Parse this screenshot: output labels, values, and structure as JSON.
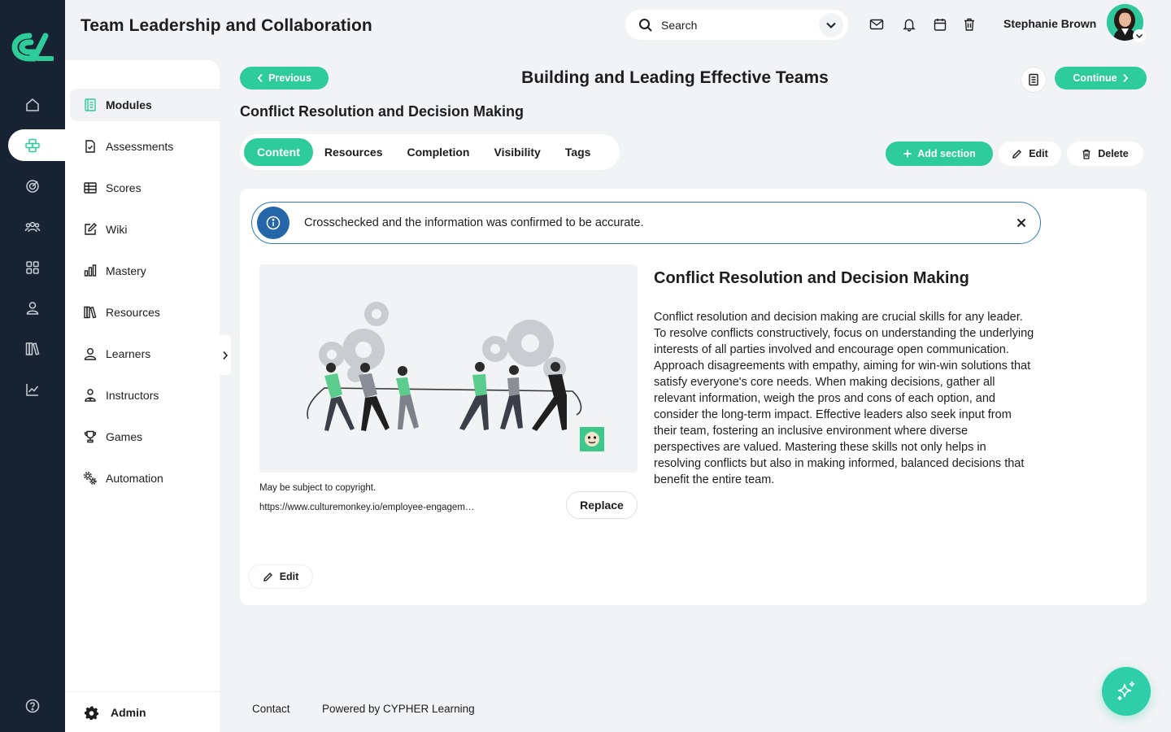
{
  "header": {
    "app_title": "Team Leadership and Collaboration",
    "search_placeholder": "Search",
    "user_name": "Stephanie Brown"
  },
  "sidebar": {
    "items": [
      {
        "label": "Modules",
        "icon": "modules-icon",
        "active": true
      },
      {
        "label": "Assessments",
        "icon": "assessments-icon"
      },
      {
        "label": "Scores",
        "icon": "scores-icon"
      },
      {
        "label": "Wiki",
        "icon": "wiki-icon"
      },
      {
        "label": "Mastery",
        "icon": "mastery-icon"
      },
      {
        "label": "Resources",
        "icon": "resources-icon"
      },
      {
        "label": "Learners",
        "icon": "learners-icon"
      },
      {
        "label": "Instructors",
        "icon": "instructors-icon"
      },
      {
        "label": "Games",
        "icon": "games-icon"
      },
      {
        "label": "Automation",
        "icon": "automation-icon"
      }
    ],
    "admin_label": "Admin"
  },
  "course": {
    "previous_label": "Previous",
    "title": "Building and Leading Effective Teams",
    "continue_label": "Continue",
    "module_title": "Conflict Resolution and Decision Making"
  },
  "tabs": [
    {
      "label": "Content",
      "active": true
    },
    {
      "label": "Resources"
    },
    {
      "label": "Completion"
    },
    {
      "label": "Visibility"
    },
    {
      "label": "Tags"
    }
  ],
  "actions": {
    "add_section": "Add section",
    "edit": "Edit",
    "delete": "Delete"
  },
  "alert": {
    "text": "Crosschecked and the information was confirmed to be accurate."
  },
  "section": {
    "title": "Conflict Resolution and Decision Making",
    "body": "Conflict resolution and decision making are crucial skills for any leader. To resolve conflicts constructively, focus on understanding the underlying interests of all parties involved and encourage open communication. Approach disagreements with empathy, aiming for win-win solutions that satisfy everyone's core needs. When making decisions, gather all relevant information, weigh the pros and cons of each option, and consider the long-term impact. Effective leaders also seek input from their team, fostering an inclusive environment where diverse perspectives are valued. Mastering these skills not only helps in resolving conflicts but also in making informed, balanced decisions that benefit the entire team.",
    "copyright": "May be subject to copyright.",
    "source_url": "https://www.culturemonkey.io/employee-engagement/",
    "replace_label": "Replace",
    "edit_label": "Edit"
  },
  "footer": {
    "contact": "Contact",
    "powered_by": "Powered by CYPHER Learning"
  },
  "colors": {
    "rail": "#172233",
    "accent": "#2ecc99",
    "info": "#2466a8"
  }
}
